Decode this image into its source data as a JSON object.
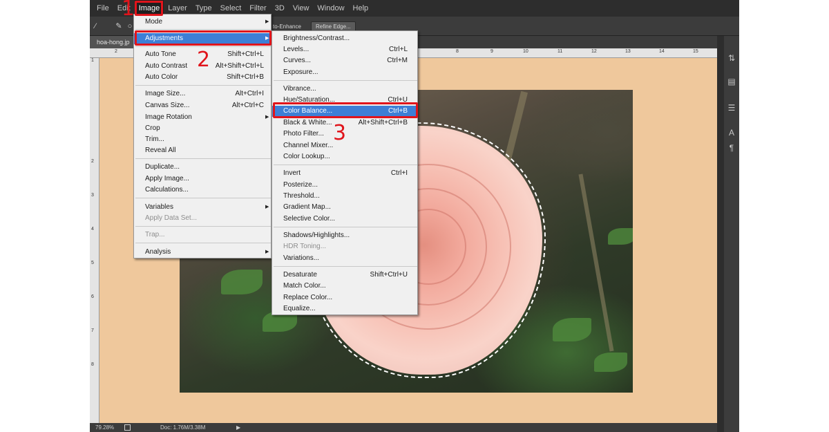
{
  "menubar": {
    "items": [
      "File",
      "Edit",
      "Image",
      "Layer",
      "Type",
      "Select",
      "Filter",
      "3D",
      "View",
      "Window",
      "Help"
    ]
  },
  "options_bar": {
    "auto_enhance_label": "to-Enhance",
    "refine_edge_label": "Refine Edge..."
  },
  "document": {
    "tab_label": "hoa-hong.jp"
  },
  "rulers": {
    "horizontal": [
      "2",
      "8",
      "9",
      "10",
      "11",
      "12",
      "13",
      "14",
      "15"
    ],
    "vertical": [
      "1",
      "2",
      "3",
      "4",
      "5",
      "6",
      "7",
      "8"
    ]
  },
  "image_menu": {
    "items": [
      {
        "label": "Mode",
        "shortcut": "",
        "submenu": true
      },
      {
        "label": "Adjustments",
        "shortcut": "",
        "submenu": true,
        "highlighted": true
      },
      {
        "label": "Auto Tone",
        "shortcut": "Shift+Ctrl+L"
      },
      {
        "label": "Auto Contrast",
        "shortcut": "Alt+Shift+Ctrl+L"
      },
      {
        "label": "Auto Color",
        "shortcut": "Shift+Ctrl+B"
      },
      {
        "label": "Image Size...",
        "shortcut": "Alt+Ctrl+I"
      },
      {
        "label": "Canvas Size...",
        "shortcut": "Alt+Ctrl+C"
      },
      {
        "label": "Image Rotation",
        "shortcut": "",
        "submenu": true
      },
      {
        "label": "Crop",
        "shortcut": ""
      },
      {
        "label": "Trim...",
        "shortcut": ""
      },
      {
        "label": "Reveal All",
        "shortcut": ""
      },
      {
        "label": "Duplicate...",
        "shortcut": ""
      },
      {
        "label": "Apply Image...",
        "shortcut": ""
      },
      {
        "label": "Calculations...",
        "shortcut": ""
      },
      {
        "label": "Variables",
        "shortcut": "",
        "submenu": true
      },
      {
        "label": "Apply Data Set...",
        "shortcut": "",
        "disabled": true
      },
      {
        "label": "Trap...",
        "shortcut": "",
        "disabled": true
      },
      {
        "label": "Analysis",
        "shortcut": "",
        "submenu": true
      }
    ]
  },
  "adjustments_menu": {
    "items": [
      {
        "label": "Brightness/Contrast...",
        "shortcut": ""
      },
      {
        "label": "Levels...",
        "shortcut": "Ctrl+L"
      },
      {
        "label": "Curves...",
        "shortcut": "Ctrl+M"
      },
      {
        "label": "Exposure...",
        "shortcut": ""
      },
      {
        "label": "Vibrance...",
        "shortcut": ""
      },
      {
        "label": "Hue/Saturation...",
        "shortcut": "Ctrl+U"
      },
      {
        "label": "Color Balance...",
        "shortcut": "Ctrl+B",
        "highlighted": true
      },
      {
        "label": "Black & White...",
        "shortcut": "Alt+Shift+Ctrl+B"
      },
      {
        "label": "Photo Filter...",
        "shortcut": ""
      },
      {
        "label": "Channel Mixer...",
        "shortcut": ""
      },
      {
        "label": "Color Lookup...",
        "shortcut": ""
      },
      {
        "label": "Invert",
        "shortcut": "Ctrl+I"
      },
      {
        "label": "Posterize...",
        "shortcut": ""
      },
      {
        "label": "Threshold...",
        "shortcut": ""
      },
      {
        "label": "Gradient Map...",
        "shortcut": ""
      },
      {
        "label": "Selective Color...",
        "shortcut": ""
      },
      {
        "label": "Shadows/Highlights...",
        "shortcut": ""
      },
      {
        "label": "HDR Toning...",
        "shortcut": "",
        "disabled": true
      },
      {
        "label": "Variations...",
        "shortcut": ""
      },
      {
        "label": "Desaturate",
        "shortcut": "Shift+Ctrl+U"
      },
      {
        "label": "Match Color...",
        "shortcut": ""
      },
      {
        "label": "Replace Color...",
        "shortcut": ""
      },
      {
        "label": "Equalize...",
        "shortcut": ""
      }
    ]
  },
  "callouts": [
    "1",
    "2",
    "3"
  ],
  "status_bar": {
    "zoom": "79.28%",
    "doc_size": "Doc: 1.76M/3.38M"
  },
  "colors": {
    "highlight": "#3d7fd6",
    "callout_red": "#e0141b",
    "canvas_bg": "#efc89c"
  }
}
